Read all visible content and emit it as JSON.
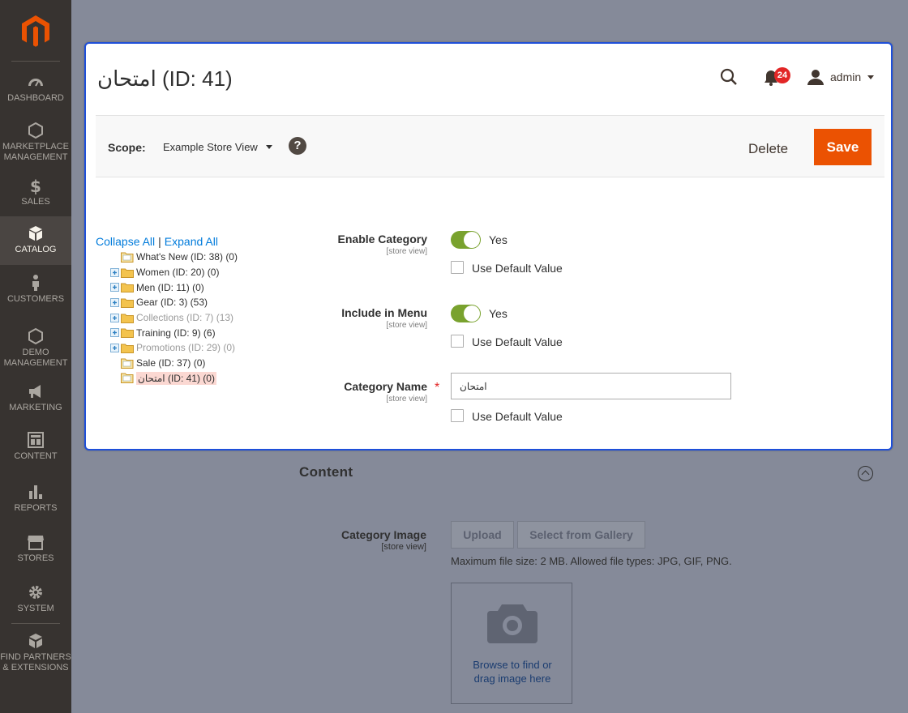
{
  "sidebar": {
    "items": [
      {
        "label": "DASHBOARD",
        "icon": "dashboard-icon"
      },
      {
        "label": "MARKETPLACE MANAGEMENT",
        "icon": "hexagon-icon"
      },
      {
        "label": "SALES",
        "icon": "dollar-icon"
      },
      {
        "label": "CATALOG",
        "icon": "cube-icon",
        "active": true
      },
      {
        "label": "CUSTOMERS",
        "icon": "person-icon"
      },
      {
        "label": "DEMO MANAGEMENT",
        "icon": "hexagon-icon"
      },
      {
        "label": "MARKETING",
        "icon": "megaphone-icon"
      },
      {
        "label": "CONTENT",
        "icon": "layout-icon"
      },
      {
        "label": "REPORTS",
        "icon": "bar-chart-icon"
      },
      {
        "label": "STORES",
        "icon": "store-icon"
      },
      {
        "label": "SYSTEM",
        "icon": "gear-icon"
      },
      {
        "label": "FIND PARTNERS & EXTENSIONS",
        "icon": "blocks-icon"
      }
    ]
  },
  "header": {
    "page_title": "امتحان (ID: 41)",
    "notification_count": "24",
    "user_name": "admin"
  },
  "scope_bar": {
    "scope_label": "Scope:",
    "scope_value": "Example Store View",
    "help_label": "?",
    "delete_label": "Delete",
    "save_label": "Save"
  },
  "tree": {
    "collapse_all": "Collapse All",
    "separator": "|",
    "expand_all": "Expand All",
    "nodes": [
      {
        "label": "What's New (ID: 38) (0)",
        "expandable": false,
        "disabled": false
      },
      {
        "label": "Women (ID: 20) (0)",
        "expandable": true,
        "disabled": false
      },
      {
        "label": "Men (ID: 11) (0)",
        "expandable": true,
        "disabled": false
      },
      {
        "label": "Gear (ID: 3) (53)",
        "expandable": true,
        "disabled": false
      },
      {
        "label": "Collections (ID: 7) (13)",
        "expandable": true,
        "disabled": true
      },
      {
        "label": "Training (ID: 9) (6)",
        "expandable": true,
        "disabled": false
      },
      {
        "label": "Promotions (ID: 29) (0)",
        "expandable": true,
        "disabled": true
      },
      {
        "label": "Sale (ID: 37) (0)",
        "expandable": false,
        "disabled": false
      },
      {
        "label": "امتحان (ID: 41) (0)",
        "expandable": false,
        "disabled": false,
        "selected": true
      }
    ]
  },
  "form": {
    "enable_category": {
      "label": "Enable Category",
      "scope": "[store view]",
      "value": "Yes",
      "default_label": "Use Default Value"
    },
    "include_in_menu": {
      "label": "Include in Menu",
      "scope": "[store view]",
      "value": "Yes",
      "default_label": "Use Default Value"
    },
    "category_name": {
      "label": "Category Name",
      "scope": "[store view]",
      "required_mark": "*",
      "value": "امتحان",
      "default_label": "Use Default Value"
    }
  },
  "content_section": {
    "title": "Content",
    "image_label": "Category Image",
    "image_scope": "[store view]",
    "upload_label": "Upload",
    "gallery_label": "Select from Gallery",
    "note": "Maximum file size: 2 MB. Allowed file types: JPG, GIF, PNG.",
    "drop_text_line1": "Browse to find or",
    "drop_text_line2": "drag image here"
  },
  "colors": {
    "accent": "#eb5202",
    "modal_border": "#1e4fd9",
    "toggle_on": "#79a22e",
    "link": "#007bdb",
    "badge": "#e22626"
  }
}
